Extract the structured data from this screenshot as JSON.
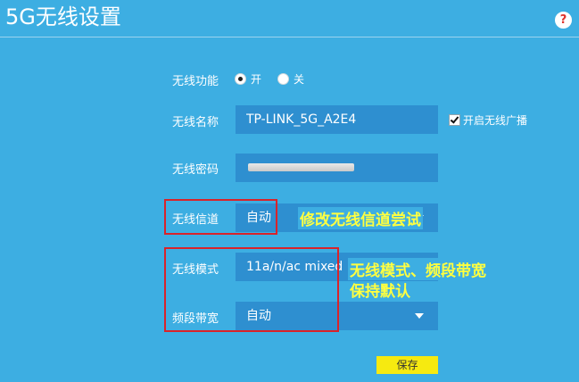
{
  "header": {
    "title": "5G无线设置",
    "help_icon": "?"
  },
  "form": {
    "wireless_function": {
      "label": "无线功能",
      "options": [
        "开",
        "关"
      ],
      "selected": "开"
    },
    "ssid": {
      "label": "无线名称",
      "value": "TP-LINK_5G_A2E4",
      "broadcast_label": "开启无线广播",
      "broadcast_checked": true
    },
    "password": {
      "label": "无线密码"
    },
    "channel": {
      "label": "无线信道",
      "value": "自动"
    },
    "mode": {
      "label": "无线模式",
      "value": "11a/n/ac mixed"
    },
    "bandwidth": {
      "label": "频段带宽",
      "value": "自动"
    },
    "save_label": "保存"
  },
  "annotations": {
    "channel_note": "修改无线信道尝试",
    "mode_note_line1": "无线模式、频段带宽",
    "mode_note_line2": "保持默认"
  },
  "colors": {
    "background": "#3daee2",
    "field": "#2e8fd0",
    "annotation_text": "#ffff40",
    "highlight_box": "#d9232a",
    "save_button": "#f6ea10"
  }
}
